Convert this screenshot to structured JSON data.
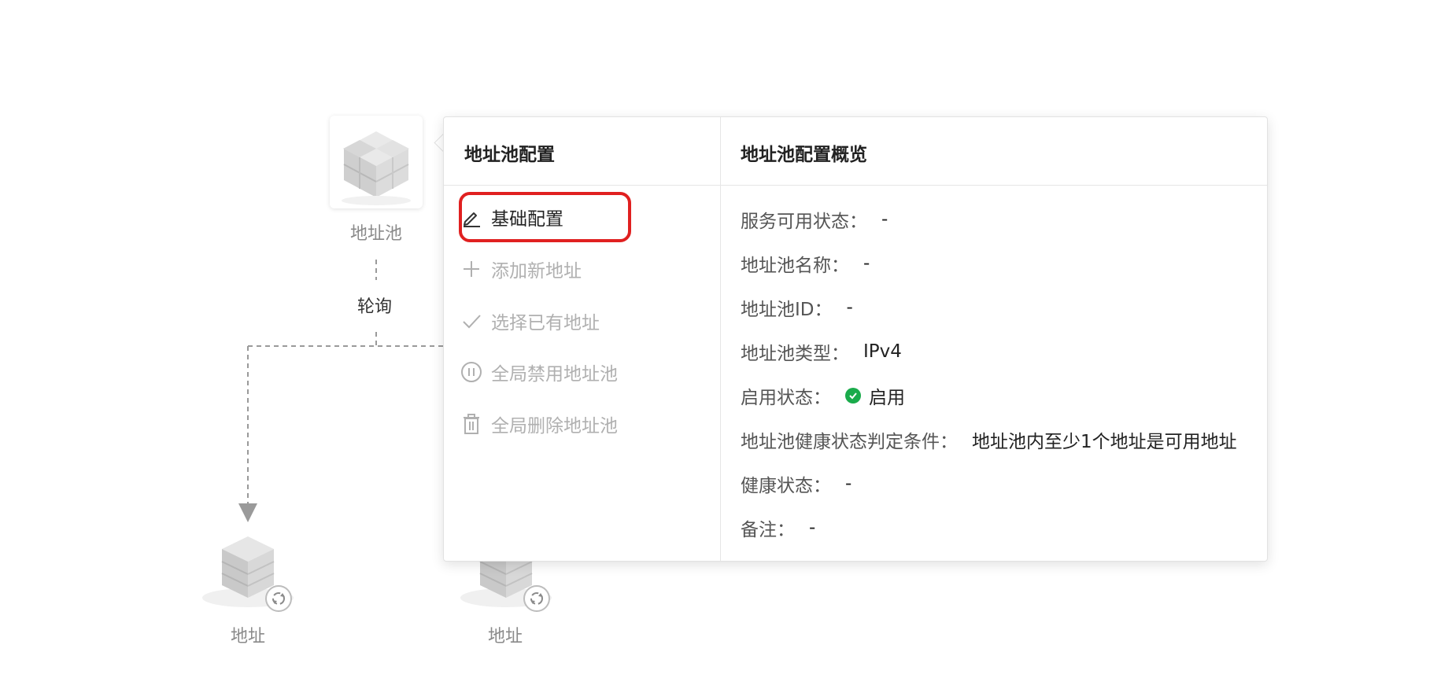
{
  "canvas": {
    "pool_node": {
      "label": "地址池",
      "icon": "address-pool-cube-icon"
    },
    "edge_label": "轮询",
    "address_nodes": [
      {
        "label": "地址",
        "icon": "address-server-icon",
        "badge_icon": "sync-icon"
      },
      {
        "label": "地址",
        "icon": "address-server-icon",
        "badge_icon": "sync-icon"
      }
    ]
  },
  "popover": {
    "left_title": "地址池配置",
    "right_title": "地址池配置概览",
    "menu": [
      {
        "label": "基础配置",
        "icon": "edit-icon",
        "enabled": true
      },
      {
        "label": "添加新地址",
        "icon": "plus-icon",
        "enabled": false
      },
      {
        "label": "选择已有地址",
        "icon": "check-icon",
        "enabled": false
      },
      {
        "label": "全局禁用地址池",
        "icon": "pause-circle-icon",
        "enabled": false
      },
      {
        "label": "全局删除地址池",
        "icon": "trash-icon",
        "enabled": false
      }
    ],
    "overview": [
      {
        "key": "服务可用状态：",
        "value": "-"
      },
      {
        "key": "地址池名称：",
        "value": "-"
      },
      {
        "key": "地址池ID：",
        "value": "-"
      },
      {
        "key": "地址池类型：",
        "value": "IPv4"
      },
      {
        "key": "启用状态：",
        "value": "启用",
        "status_color": "#1aab4b"
      },
      {
        "key": "地址池健康状态判定条件：",
        "value": "地址池内至少1个地址是可用地址"
      },
      {
        "key": "健康状态：",
        "value": "-"
      },
      {
        "key": "备注：",
        "value": "-"
      }
    ]
  },
  "colors": {
    "highlight": "#e02020",
    "enabled_green": "#1aab4b"
  }
}
